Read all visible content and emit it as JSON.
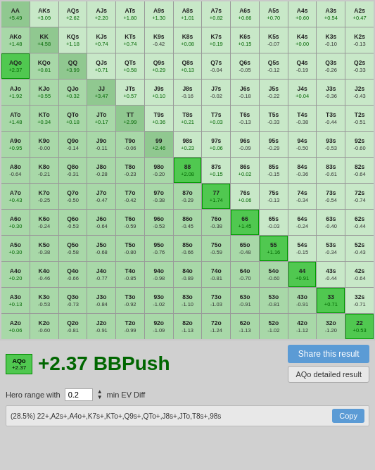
{
  "grid": {
    "cells": [
      {
        "hand": "AA",
        "ev": "+5.49",
        "type": "pair"
      },
      {
        "hand": "AKs",
        "ev": "+3.09",
        "type": "suited"
      },
      {
        "hand": "AQs",
        "ev": "+2.62",
        "type": "suited"
      },
      {
        "hand": "AJs",
        "ev": "+2.20",
        "type": "suited"
      },
      {
        "hand": "ATs",
        "ev": "+1.80",
        "type": "suited"
      },
      {
        "hand": "A9s",
        "ev": "+1.30",
        "type": "suited"
      },
      {
        "hand": "A8s",
        "ev": "+1.01",
        "type": "suited"
      },
      {
        "hand": "A7s",
        "ev": "+0.82",
        "type": "suited"
      },
      {
        "hand": "A6s",
        "ev": "+0.66",
        "type": "suited"
      },
      {
        "hand": "A5s",
        "ev": "+0.70",
        "type": "suited"
      },
      {
        "hand": "A4s",
        "ev": "+0.60",
        "type": "suited"
      },
      {
        "hand": "A3s",
        "ev": "+0.54",
        "type": "suited"
      },
      {
        "hand": "A2s",
        "ev": "+0.47",
        "type": "suited"
      },
      {
        "hand": "AKo",
        "ev": "+1.48",
        "type": "offsuit"
      },
      {
        "hand": "KK",
        "ev": "+4.58",
        "type": "pair"
      },
      {
        "hand": "KQs",
        "ev": "+1.18",
        "type": "suited"
      },
      {
        "hand": "KJs",
        "ev": "+0.74",
        "type": "suited"
      },
      {
        "hand": "KTs",
        "ev": "+0.74",
        "type": "suited"
      },
      {
        "hand": "K9s",
        "ev": "-0.42",
        "type": "suited"
      },
      {
        "hand": "K8s",
        "ev": "+0.08",
        "type": "suited"
      },
      {
        "hand": "K7s",
        "ev": "+0.19",
        "type": "suited"
      },
      {
        "hand": "K6s",
        "ev": "+0.15",
        "type": "suited"
      },
      {
        "hand": "K5s",
        "ev": "-0.07",
        "type": "suited"
      },
      {
        "hand": "K4s",
        "ev": "+0.00",
        "type": "suited"
      },
      {
        "hand": "K3s",
        "ev": "-0.10",
        "type": "suited"
      },
      {
        "hand": "K2s",
        "ev": "-0.13",
        "type": "suited"
      },
      {
        "hand": "AQo",
        "ev": "+2.37",
        "type": "offsuit",
        "highlight": true
      },
      {
        "hand": "KQo",
        "ev": "+0.81",
        "type": "offsuit"
      },
      {
        "hand": "QQ",
        "ev": "+3.99",
        "type": "pair"
      },
      {
        "hand": "QJs",
        "ev": "+0.71",
        "type": "suited"
      },
      {
        "hand": "QTs",
        "ev": "+0.58",
        "type": "suited"
      },
      {
        "hand": "Q9s",
        "ev": "+0.29",
        "type": "suited"
      },
      {
        "hand": "Q8s",
        "ev": "+0.13",
        "type": "suited"
      },
      {
        "hand": "Q7s",
        "ev": "-0.04",
        "type": "suited"
      },
      {
        "hand": "Q6s",
        "ev": "-0.05",
        "type": "suited"
      },
      {
        "hand": "Q5s",
        "ev": "-0.12",
        "type": "suited"
      },
      {
        "hand": "Q4s",
        "ev": "-0.19",
        "type": "suited"
      },
      {
        "hand": "Q3s",
        "ev": "-0.26",
        "type": "suited"
      },
      {
        "hand": "Q2s",
        "ev": "-0.33",
        "type": "suited"
      },
      {
        "hand": "AJo",
        "ev": "+1.92",
        "type": "offsuit"
      },
      {
        "hand": "KJo",
        "ev": "+0.55",
        "type": "offsuit"
      },
      {
        "hand": "QJo",
        "ev": "+0.32",
        "type": "offsuit"
      },
      {
        "hand": "JJ",
        "ev": "+3.47",
        "type": "pair"
      },
      {
        "hand": "JTs",
        "ev": "+0.57",
        "type": "suited"
      },
      {
        "hand": "J9s",
        "ev": "+0.10",
        "type": "suited"
      },
      {
        "hand": "J8s",
        "ev": "-0.16",
        "type": "suited"
      },
      {
        "hand": "J7s",
        "ev": "-0.02",
        "type": "suited"
      },
      {
        "hand": "J6s",
        "ev": "-0.18",
        "type": "suited"
      },
      {
        "hand": "J5s",
        "ev": "-0.22",
        "type": "suited"
      },
      {
        "hand": "J4s",
        "ev": "+0.04",
        "type": "suited"
      },
      {
        "hand": "J3s",
        "ev": "-0.36",
        "type": "suited"
      },
      {
        "hand": "J2s",
        "ev": "-0.43",
        "type": "suited"
      },
      {
        "hand": "ATo",
        "ev": "+1.48",
        "type": "offsuit"
      },
      {
        "hand": "KTo",
        "ev": "+0.34",
        "type": "offsuit"
      },
      {
        "hand": "QTo",
        "ev": "+0.18",
        "type": "offsuit"
      },
      {
        "hand": "JTo",
        "ev": "+0.17",
        "type": "offsuit"
      },
      {
        "hand": "TT",
        "ev": "+2.99",
        "type": "pair"
      },
      {
        "hand": "T9s",
        "ev": "+0.36",
        "type": "suited"
      },
      {
        "hand": "T8s",
        "ev": "+0.21",
        "type": "suited"
      },
      {
        "hand": "T7s",
        "ev": "+0.03",
        "type": "suited"
      },
      {
        "hand": "T6s",
        "ev": "-0.13",
        "type": "suited"
      },
      {
        "hand": "T5s",
        "ev": "-0.33",
        "type": "suited"
      },
      {
        "hand": "T4s",
        "ev": "-0.38",
        "type": "suited"
      },
      {
        "hand": "T3s",
        "ev": "-0.44",
        "type": "suited"
      },
      {
        "hand": "T2s",
        "ev": "-0.51",
        "type": "suited"
      },
      {
        "hand": "A9o",
        "ev": "+0.95",
        "type": "offsuit"
      },
      {
        "hand": "K9o",
        "ev": "-0.00",
        "type": "offsuit"
      },
      {
        "hand": "Q9o",
        "ev": "-0.14",
        "type": "offsuit"
      },
      {
        "hand": "J9o",
        "ev": "-0.11",
        "type": "offsuit"
      },
      {
        "hand": "T9o",
        "ev": "-0.06",
        "type": "offsuit"
      },
      {
        "hand": "99",
        "ev": "+2.46",
        "type": "pair"
      },
      {
        "hand": "98s",
        "ev": "+0.23",
        "type": "suited"
      },
      {
        "hand": "97s",
        "ev": "+0.06",
        "type": "suited"
      },
      {
        "hand": "96s",
        "ev": "-0.09",
        "type": "suited"
      },
      {
        "hand": "95s",
        "ev": "-0.29",
        "type": "suited"
      },
      {
        "hand": "94s",
        "ev": "-0.50",
        "type": "suited"
      },
      {
        "hand": "93s",
        "ev": "-0.53",
        "type": "suited"
      },
      {
        "hand": "92s",
        "ev": "-0.60",
        "type": "suited"
      },
      {
        "hand": "A8o",
        "ev": "-0.64",
        "type": "offsuit"
      },
      {
        "hand": "K8o",
        "ev": "-0.21",
        "type": "offsuit"
      },
      {
        "hand": "Q8o",
        "ev": "-0.31",
        "type": "offsuit"
      },
      {
        "hand": "J8o",
        "ev": "-0.28",
        "type": "offsuit"
      },
      {
        "hand": "T8o",
        "ev": "-0.23",
        "type": "offsuit"
      },
      {
        "hand": "98o",
        "ev": "-0.20",
        "type": "offsuit"
      },
      {
        "hand": "88",
        "ev": "+2.08",
        "type": "pair",
        "highlight": true
      },
      {
        "hand": "87s",
        "ev": "+0.15",
        "type": "suited"
      },
      {
        "hand": "86s",
        "ev": "+0.02",
        "type": "suited"
      },
      {
        "hand": "85s",
        "ev": "-0.15",
        "type": "suited"
      },
      {
        "hand": "84s",
        "ev": "-0.36",
        "type": "suited"
      },
      {
        "hand": "83s",
        "ev": "-0.61",
        "type": "suited"
      },
      {
        "hand": "82s",
        "ev": "-0.64",
        "type": "suited"
      },
      {
        "hand": "A7o",
        "ev": "+0.43",
        "type": "offsuit"
      },
      {
        "hand": "K7o",
        "ev": "-0.25",
        "type": "offsuit"
      },
      {
        "hand": "Q7o",
        "ev": "-0.50",
        "type": "offsuit"
      },
      {
        "hand": "J7o",
        "ev": "-0.47",
        "type": "offsuit"
      },
      {
        "hand": "T7o",
        "ev": "-0.42",
        "type": "offsuit"
      },
      {
        "hand": "97o",
        "ev": "-0.38",
        "type": "offsuit"
      },
      {
        "hand": "87o",
        "ev": "-0.29",
        "type": "offsuit"
      },
      {
        "hand": "77",
        "ev": "+1.74",
        "type": "pair",
        "highlight": true
      },
      {
        "hand": "76s",
        "ev": "+0.06",
        "type": "suited"
      },
      {
        "hand": "75s",
        "ev": "-0.13",
        "type": "suited"
      },
      {
        "hand": "74s",
        "ev": "-0.34",
        "type": "suited"
      },
      {
        "hand": "73s",
        "ev": "-0.54",
        "type": "suited"
      },
      {
        "hand": "72s",
        "ev": "-0.74",
        "type": "suited"
      },
      {
        "hand": "A6o",
        "ev": "+0.30",
        "type": "offsuit"
      },
      {
        "hand": "K6o",
        "ev": "-0.24",
        "type": "offsuit"
      },
      {
        "hand": "Q6o",
        "ev": "-0.53",
        "type": "offsuit"
      },
      {
        "hand": "J6o",
        "ev": "-0.64",
        "type": "offsuit"
      },
      {
        "hand": "T6o",
        "ev": "-0.59",
        "type": "offsuit"
      },
      {
        "hand": "96o",
        "ev": "-0.53",
        "type": "offsuit"
      },
      {
        "hand": "86o",
        "ev": "-0.45",
        "type": "offsuit"
      },
      {
        "hand": "76o",
        "ev": "-0.38",
        "type": "offsuit"
      },
      {
        "hand": "66",
        "ev": "+1.45",
        "type": "pair",
        "highlight": true
      },
      {
        "hand": "65s",
        "ev": "-0.03",
        "type": "suited"
      },
      {
        "hand": "64s",
        "ev": "-0.24",
        "type": "suited"
      },
      {
        "hand": "63s",
        "ev": "-0.40",
        "type": "suited"
      },
      {
        "hand": "62s",
        "ev": "-0.44",
        "type": "suited"
      },
      {
        "hand": "A5o",
        "ev": "+0.30",
        "type": "offsuit"
      },
      {
        "hand": "K5o",
        "ev": "-0.38",
        "type": "offsuit"
      },
      {
        "hand": "Q5o",
        "ev": "-0.58",
        "type": "offsuit"
      },
      {
        "hand": "J5o",
        "ev": "-0.68",
        "type": "offsuit"
      },
      {
        "hand": "T5o",
        "ev": "-0.80",
        "type": "offsuit"
      },
      {
        "hand": "95o",
        "ev": "-0.76",
        "type": "offsuit"
      },
      {
        "hand": "85o",
        "ev": "-0.66",
        "type": "offsuit"
      },
      {
        "hand": "75o",
        "ev": "-0.59",
        "type": "offsuit"
      },
      {
        "hand": "65o",
        "ev": "-0.48",
        "type": "offsuit"
      },
      {
        "hand": "55",
        "ev": "+1.16",
        "type": "pair",
        "highlight": true
      },
      {
        "hand": "54s",
        "ev": "-0.15",
        "type": "suited"
      },
      {
        "hand": "53s",
        "ev": "-0.34",
        "type": "suited"
      },
      {
        "hand": "52s",
        "ev": "-0.43",
        "type": "suited"
      },
      {
        "hand": "A4o",
        "ev": "+0.20",
        "type": "offsuit"
      },
      {
        "hand": "K4o",
        "ev": "-0.46",
        "type": "offsuit"
      },
      {
        "hand": "Q4o",
        "ev": "-0.66",
        "type": "offsuit"
      },
      {
        "hand": "J4o",
        "ev": "-0.77",
        "type": "offsuit"
      },
      {
        "hand": "T4o",
        "ev": "-0.85",
        "type": "offsuit"
      },
      {
        "hand": "94o",
        "ev": "-0.98",
        "type": "offsuit"
      },
      {
        "hand": "84o",
        "ev": "-0.89",
        "type": "offsuit"
      },
      {
        "hand": "74o",
        "ev": "-0.81",
        "type": "offsuit"
      },
      {
        "hand": "64o",
        "ev": "-0.70",
        "type": "offsuit"
      },
      {
        "hand": "54o",
        "ev": "-0.60",
        "type": "offsuit"
      },
      {
        "hand": "44",
        "ev": "+0.91",
        "type": "pair",
        "highlight": true
      },
      {
        "hand": "43s",
        "ev": "-0.44",
        "type": "suited"
      },
      {
        "hand": "42s",
        "ev": "-0.64",
        "type": "suited"
      },
      {
        "hand": "A3o",
        "ev": "+0.13",
        "type": "offsuit"
      },
      {
        "hand": "K3o",
        "ev": "-0.53",
        "type": "offsuit"
      },
      {
        "hand": "Q3o",
        "ev": "-0.73",
        "type": "offsuit"
      },
      {
        "hand": "J3o",
        "ev": "-0.84",
        "type": "offsuit"
      },
      {
        "hand": "T3o",
        "ev": "-0.92",
        "type": "offsuit"
      },
      {
        "hand": "93o",
        "ev": "-1.02",
        "type": "offsuit"
      },
      {
        "hand": "83o",
        "ev": "-1.10",
        "type": "offsuit"
      },
      {
        "hand": "73o",
        "ev": "-1.03",
        "type": "offsuit"
      },
      {
        "hand": "63o",
        "ev": "-0.91",
        "type": "offsuit"
      },
      {
        "hand": "53o",
        "ev": "-0.81",
        "type": "offsuit"
      },
      {
        "hand": "43o",
        "ev": "-0.91",
        "type": "offsuit"
      },
      {
        "hand": "33",
        "ev": "+0.71",
        "type": "pair",
        "highlight": true
      },
      {
        "hand": "32s",
        "ev": "-0.71",
        "type": "suited"
      },
      {
        "hand": "A2o",
        "ev": "+0.06",
        "type": "offsuit"
      },
      {
        "hand": "K2o",
        "ev": "-0.60",
        "type": "offsuit"
      },
      {
        "hand": "Q2o",
        "ev": "-0.81",
        "type": "offsuit"
      },
      {
        "hand": "J2o",
        "ev": "-0.91",
        "type": "offsuit"
      },
      {
        "hand": "T2o",
        "ev": "-0.99",
        "type": "offsuit"
      },
      {
        "hand": "92o",
        "ev": "-1.09",
        "type": "offsuit"
      },
      {
        "hand": "82o",
        "ev": "-1.13",
        "type": "offsuit"
      },
      {
        "hand": "72o",
        "ev": "-1.24",
        "type": "offsuit"
      },
      {
        "hand": "62o",
        "ev": "-1.13",
        "type": "offsuit"
      },
      {
        "hand": "52o",
        "ev": "-1.02",
        "type": "offsuit"
      },
      {
        "hand": "42o",
        "ev": "-1.12",
        "type": "offsuit"
      },
      {
        "hand": "32o",
        "ev": "-1.20",
        "type": "offsuit"
      },
      {
        "hand": "22",
        "ev": "+0.53",
        "type": "pair",
        "highlight": true
      }
    ]
  },
  "hero": {
    "hand": "AQo",
    "ev": "+2.37",
    "value_label": "+2.37 BBPush"
  },
  "buttons": {
    "share_label": "Share this result",
    "detailed_label": "AQo detailed result",
    "copy_label": "Copy"
  },
  "hero_range": {
    "label": "Hero range with",
    "input_value": "0.2",
    "suffix": "min EV Diff"
  },
  "range_text": "(28.5%) 22+,A2s+,A4o+,K7s+,KTo+,Q9s+,QTo+,J8s+,JTo,T8s+,98s"
}
